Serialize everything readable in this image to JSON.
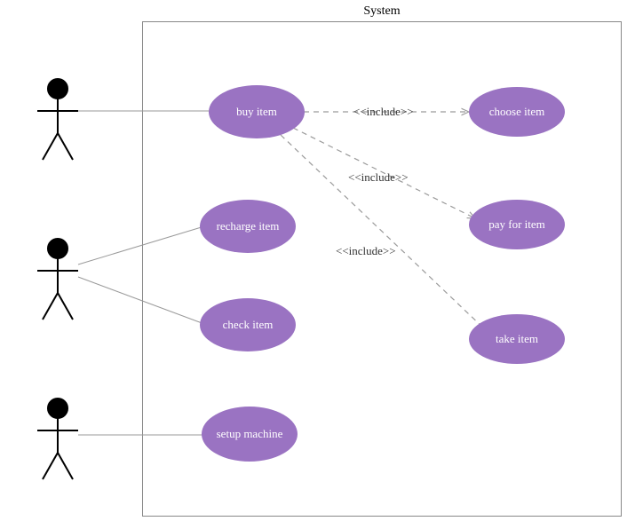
{
  "system": {
    "label": "System"
  },
  "usecases": {
    "buy": {
      "label": "buy item"
    },
    "recharge": {
      "label": "recharge  item"
    },
    "check": {
      "label": "check  item"
    },
    "setup": {
      "label": "setup machine"
    },
    "choose": {
      "label": "choose  item"
    },
    "pay": {
      "label": "pay for item"
    },
    "take": {
      "label": "take item"
    }
  },
  "includes": {
    "inc1": {
      "label": "<<include>>"
    },
    "inc2": {
      "label": "<<include>>"
    },
    "inc3": {
      "label": "<<include>>"
    }
  }
}
